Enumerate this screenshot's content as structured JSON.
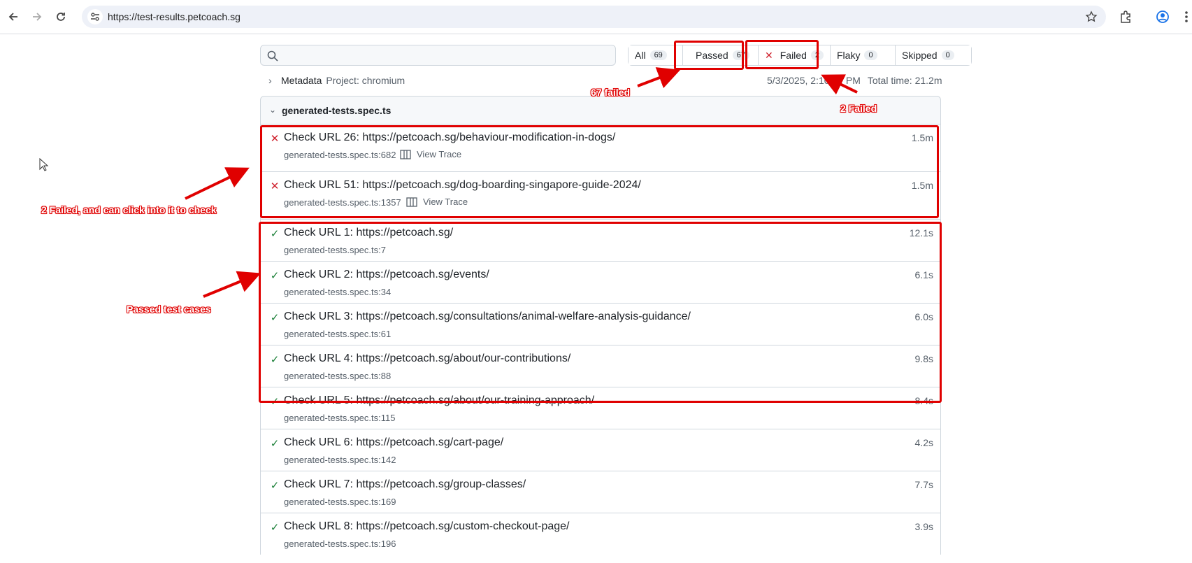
{
  "browser": {
    "url": "https://test-results.petcoach.sg"
  },
  "report": {
    "search": {
      "placeholder": "",
      "value": ""
    },
    "filters": [
      {
        "label": "All",
        "count": "69"
      },
      {
        "label": "Passed",
        "count": "67"
      },
      {
        "label": "Failed",
        "count": "2"
      },
      {
        "label": "Flaky",
        "count": "0"
      },
      {
        "label": "Skipped",
        "count": "0"
      }
    ],
    "metadata": {
      "label": "Metadata",
      "project": "Project: chromium"
    },
    "run_date": "5/3/2025, 2:10:37 PM",
    "total_time": "Total time: 21.2m",
    "file": {
      "name": "generated-tests.spec.ts"
    },
    "view_trace_label": "View Trace",
    "tests": [
      {
        "status": "failed",
        "title": "Check URL 26: https://petcoach.sg/behaviour-modification-in-dogs/",
        "duration": "1.5m",
        "location": "generated-tests.spec.ts:682"
      },
      {
        "status": "failed",
        "title": "Check URL 51: https://petcoach.sg/dog-boarding-singapore-guide-2024/",
        "duration": "1.5m",
        "location": "generated-tests.spec.ts:1357"
      },
      {
        "status": "passed",
        "title": "Check URL 1: https://petcoach.sg/",
        "duration": "12.1s",
        "location": "generated-tests.spec.ts:7"
      },
      {
        "status": "passed",
        "title": "Check URL 2: https://petcoach.sg/events/",
        "duration": "6.1s",
        "location": "generated-tests.spec.ts:34"
      },
      {
        "status": "passed",
        "title": "Check URL 3: https://petcoach.sg/consultations/animal-welfare-analysis-guidance/",
        "duration": "6.0s",
        "location": "generated-tests.spec.ts:61"
      },
      {
        "status": "passed",
        "title": "Check URL 4: https://petcoach.sg/about/our-contributions/",
        "duration": "9.8s",
        "location": "generated-tests.spec.ts:88"
      },
      {
        "status": "passed",
        "title": "Check URL 5: https://petcoach.sg/about/our-training-approach/",
        "duration": "8.4s",
        "location": "generated-tests.spec.ts:115"
      },
      {
        "status": "passed",
        "title": "Check URL 6: https://petcoach.sg/cart-page/",
        "duration": "4.2s",
        "location": "generated-tests.spec.ts:142"
      },
      {
        "status": "passed",
        "title": "Check URL 7: https://petcoach.sg/group-classes/",
        "duration": "7.7s",
        "location": "generated-tests.spec.ts:169"
      },
      {
        "status": "passed",
        "title": "Check URL 8: https://petcoach.sg/custom-checkout-page/",
        "duration": "3.9s",
        "location": "generated-tests.spec.ts:196"
      }
    ]
  },
  "annotations": {
    "passed_note": "67 failed",
    "failed_note": "2 Failed",
    "failed_rows_note": "2 Failed, and can click into it to check",
    "passed_rows_note": "Passed test cases",
    "color": "#e00000"
  }
}
